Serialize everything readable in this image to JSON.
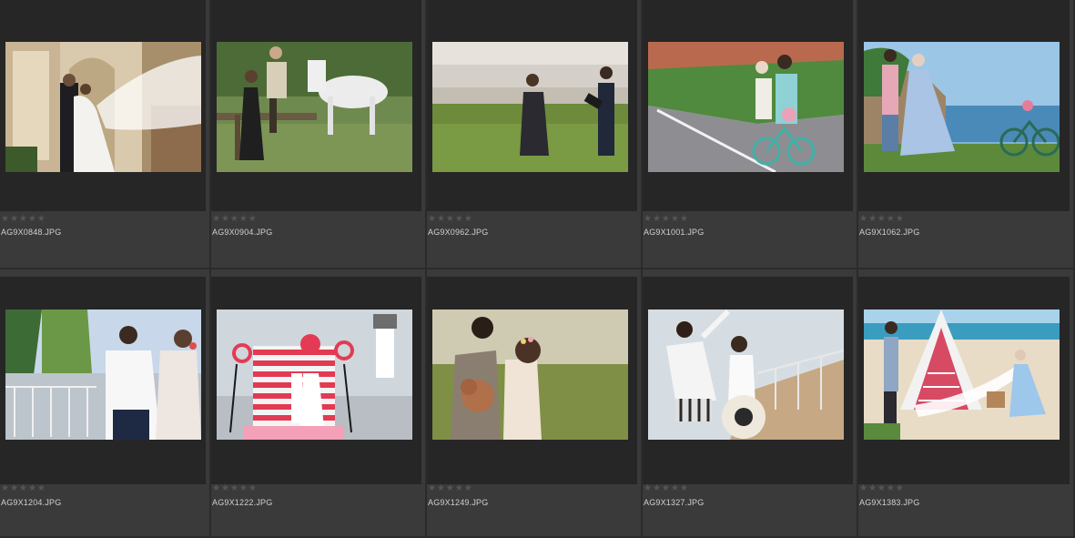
{
  "grid": {
    "items": [
      {
        "filename": "AG9X0848.JPG",
        "rating": 0,
        "rating_symbol": "★★★★★",
        "scene": "castle-veil"
      },
      {
        "filename": "AG9X0904.JPG",
        "rating": 0,
        "rating_symbol": "★★★★★",
        "scene": "horse-meadow"
      },
      {
        "filename": "AG9X0962.JPG",
        "rating": 0,
        "rating_symbol": "★★★★★",
        "scene": "beach-grass"
      },
      {
        "filename": "AG9X1001.JPG",
        "rating": 0,
        "rating_symbol": "★★★★★",
        "scene": "road-bicycle"
      },
      {
        "filename": "AG9X1062.JPG",
        "rating": 0,
        "rating_symbol": "★★★★★",
        "scene": "coast-bicycle"
      },
      {
        "filename": "AG9X1204.JPG",
        "rating": 0,
        "rating_symbol": "★★★★★",
        "scene": "palm-railing"
      },
      {
        "filename": "AG9X1222.JPG",
        "rating": 0,
        "rating_symbol": "★★★★★",
        "scene": "lighthouse-balloons"
      },
      {
        "filename": "AG9X1249.JPG",
        "rating": 0,
        "rating_symbol": "★★★★★",
        "scene": "puppy-field"
      },
      {
        "filename": "AG9X1327.JPG",
        "rating": 0,
        "rating_symbol": "★★★★★",
        "scene": "pier-hat"
      },
      {
        "filename": "AG9X1383.JPG",
        "rating": 0,
        "rating_symbol": "★★★★★",
        "scene": "beach-tent"
      }
    ]
  },
  "colors": {
    "background": "#333333",
    "cell": "#3a3a3a",
    "well": "#262626",
    "filename_text": "#d0d0d0",
    "star_empty": "#555555"
  }
}
